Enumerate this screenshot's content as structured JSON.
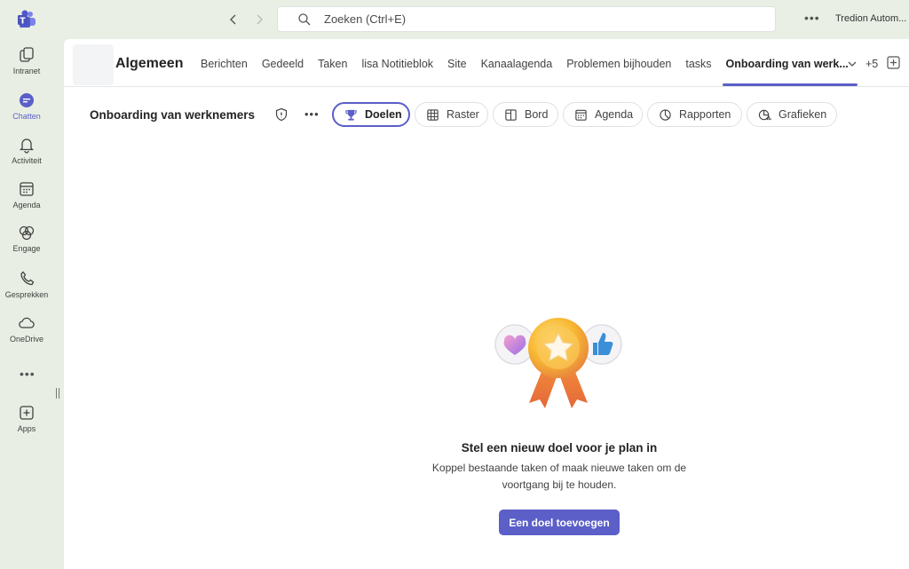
{
  "search": {
    "placeholder": "Zoeken (Ctrl+E)"
  },
  "account": {
    "name": "Tredion Autom..."
  },
  "rail": {
    "items": [
      {
        "label": "Intranet"
      },
      {
        "label": "Chatten"
      },
      {
        "label": "Activiteit"
      },
      {
        "label": "Agenda"
      },
      {
        "label": "Engage"
      },
      {
        "label": "Gesprekken"
      },
      {
        "label": "OneDrive"
      },
      {
        "label": "Apps"
      }
    ]
  },
  "channel": {
    "name": "Algemeen",
    "tabs": [
      {
        "label": "Berichten"
      },
      {
        "label": "Gedeeld"
      },
      {
        "label": "Taken"
      },
      {
        "label": "lisa Notitieblok"
      },
      {
        "label": "Site"
      },
      {
        "label": "Kanaalagenda"
      },
      {
        "label": "Problemen bijhouden"
      },
      {
        "label": "tasks"
      },
      {
        "label": "Onboarding van werk..."
      }
    ],
    "more_tabs": "+5"
  },
  "plan": {
    "title": "Onboarding van werknemers",
    "views": [
      {
        "label": "Doelen"
      },
      {
        "label": "Raster"
      },
      {
        "label": "Bord"
      },
      {
        "label": "Agenda"
      },
      {
        "label": "Rapporten"
      },
      {
        "label": "Grafieken"
      }
    ]
  },
  "empty_state": {
    "title": "Stel een nieuw doel voor je plan in",
    "description": "Koppel bestaande taken of maak nieuwe taken om de voortgang bij te houden.",
    "button": "Een doel toevoegen"
  },
  "colors": {
    "accent": "#5b5fc7",
    "rail_bg": "#e8eee3"
  }
}
